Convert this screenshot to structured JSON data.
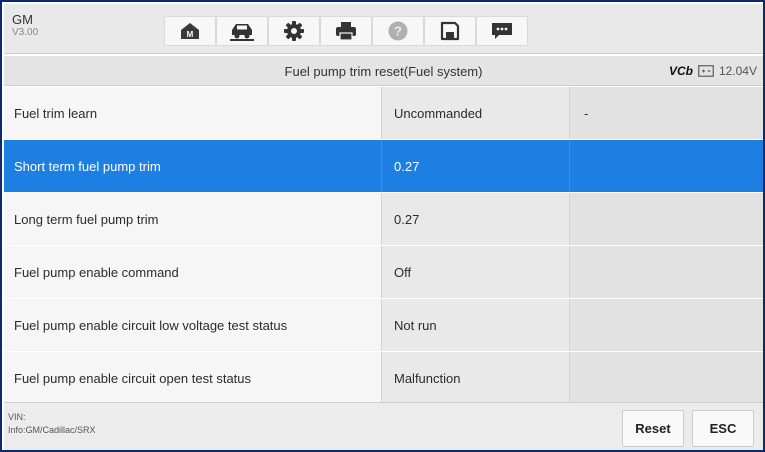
{
  "vehicle": {
    "make": "GM",
    "version": "V3.00"
  },
  "toolbar": {
    "buttons": [
      {
        "name": "home-button",
        "icon": "home-icon"
      },
      {
        "name": "vehicle-swap-button",
        "icon": "vehicle-swap-icon"
      },
      {
        "name": "settings-button",
        "icon": "gear-icon"
      },
      {
        "name": "print-button",
        "icon": "printer-icon"
      },
      {
        "name": "help-button",
        "icon": "help-icon"
      },
      {
        "name": "save-button",
        "icon": "save-icon"
      },
      {
        "name": "message-button",
        "icon": "chat-icon"
      }
    ]
  },
  "titlebar": {
    "title": "Fuel pump trim reset(Fuel system)",
    "vcb_logo": "VCb",
    "voltage": "12.04V"
  },
  "table": {
    "rows": [
      {
        "name": "Fuel trim learn",
        "value": "Uncommanded",
        "unit": "-",
        "selected": false
      },
      {
        "name": "Short term fuel pump trim",
        "value": "0.27",
        "unit": "",
        "selected": true
      },
      {
        "name": "Long term fuel pump trim",
        "value": "0.27",
        "unit": "",
        "selected": false
      },
      {
        "name": "Fuel pump enable command",
        "value": "Off",
        "unit": "",
        "selected": false
      },
      {
        "name": "Fuel pump enable circuit low voltage test status",
        "value": "Not run",
        "unit": "",
        "selected": false
      },
      {
        "name": "Fuel pump enable circuit open test status",
        "value": "Malfunction",
        "unit": "",
        "selected": false
      }
    ]
  },
  "footer": {
    "vin_label": "VIN:",
    "info": "Info:GM/Cadillac/SRX",
    "reset_label": "Reset",
    "esc_label": "ESC"
  },
  "colors": {
    "selected_row": "#1e7fe3",
    "frame_border": "#0c2a6e",
    "icon_dark": "#333333",
    "help_icon": "#9a9a9a"
  }
}
